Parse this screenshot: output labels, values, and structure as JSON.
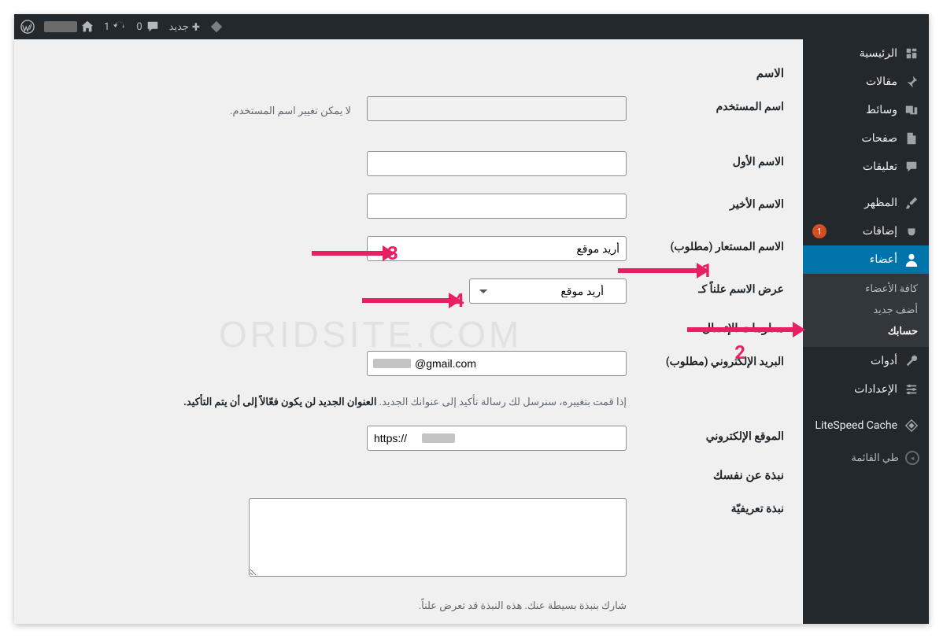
{
  "adminbar": {
    "new_label": "جديد",
    "comments_count": "0",
    "updates_count": "1"
  },
  "sidebar": {
    "dashboard": "الرئيسية",
    "posts": "مقالات",
    "media": "وسائط",
    "pages": "صفحات",
    "comments": "تعليقات",
    "appearance": "المظهر",
    "plugins": "إضافات",
    "plugins_badge": "1",
    "users": "أعضاء",
    "users_submenu": {
      "all": "كافة الأعضاء",
      "add": "أضف جديد",
      "profile": "حسابك"
    },
    "tools": "أدوات",
    "settings": "الإعدادات",
    "litespeed": "LiteSpeed Cache",
    "collapse": "طي القائمة"
  },
  "form": {
    "section_name": "الاسم",
    "username_label": "اسم المستخدم",
    "username_desc": "لا يمكن تغيير اسم المستخدم.",
    "firstname_label": "الاسم الأول",
    "lastname_label": "الاسم الأخير",
    "nickname_label": "الاسم المستعار (مطلوب)",
    "nickname_value": "أريد موقع",
    "displayname_label": "عرض الاسم علناً كـ",
    "displayname_value": "أريد موقع",
    "section_contact": "معلومات الإتصال",
    "email_label": "البريد الإلكتروني (مطلوب)",
    "email_value": "@gmail.com",
    "email_desc_pre": "إذا قمت بتغييره، سنرسل لك رسالة تأكيد إلى عنوانك الجديد. ",
    "email_desc_strong": "العنوان الجديد لن يكون فعّالاً إلى أن يتم التأكيد.",
    "website_label": "الموقع الإلكتروني",
    "website_value": "https://        .com",
    "section_about": "نبذة عن نفسك",
    "bio_label": "نبذة تعريفيّة",
    "bio_desc": "شارك بنبذة بسيطة عنك. هذه النبذة قد تعرض علناً."
  },
  "annotations": {
    "a1": "1",
    "a2": "2",
    "a3": "3",
    "a4": "4"
  },
  "watermark": "ORIDSITE.COM"
}
